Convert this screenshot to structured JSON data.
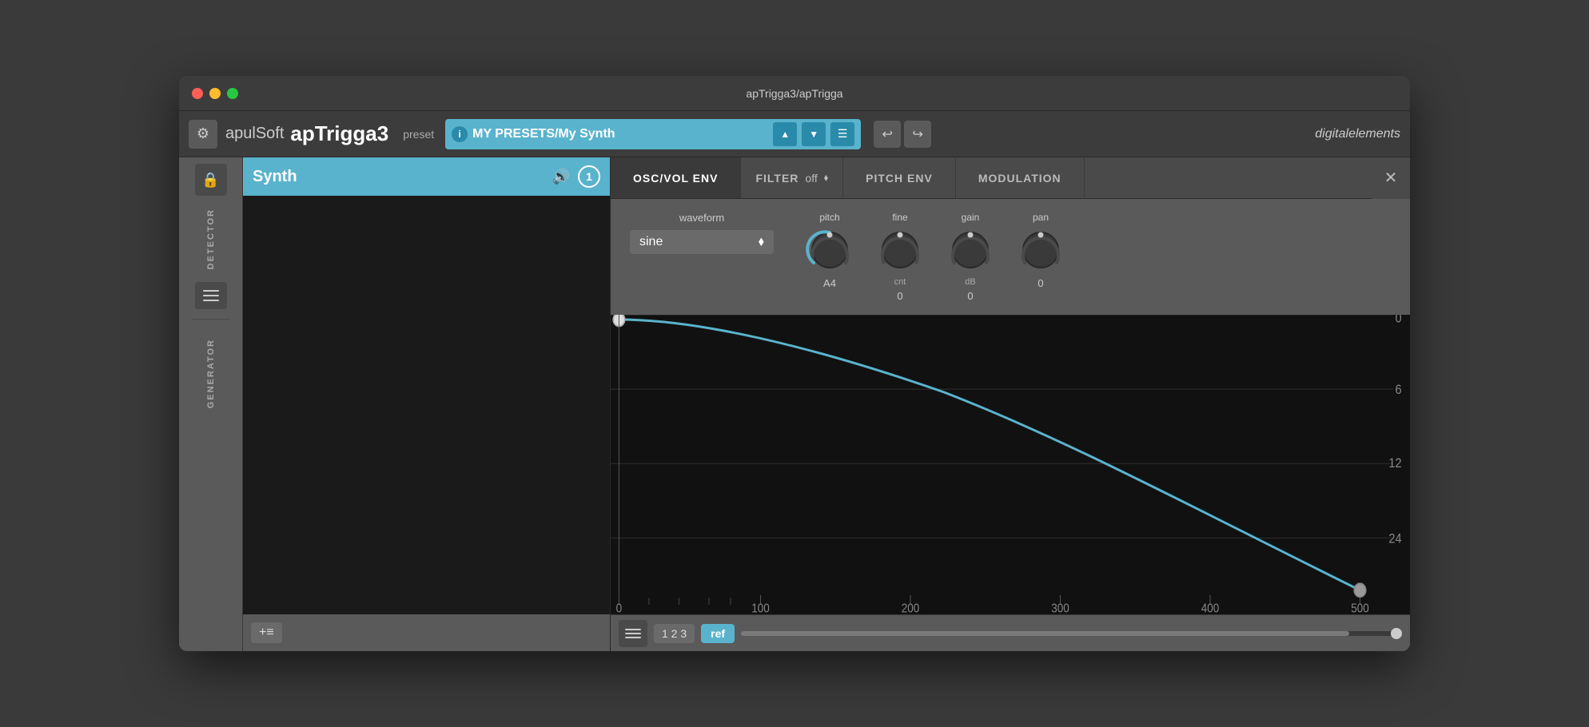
{
  "window": {
    "title": "apTrigga3/apTrigga"
  },
  "titlebar": {
    "title": "apTrigga3/apTrigga",
    "close_btn": "×",
    "min_btn": "–",
    "max_btn": "+"
  },
  "toolbar": {
    "gear_icon": "⚙",
    "brand_light": "apulSoft",
    "brand_bold": "apTrigga3",
    "preset_label": "preset",
    "preset_info_icon": "i",
    "preset_name": "MY PRESETS/My Synth",
    "nav_up": "▲",
    "nav_down": "▼",
    "menu_icon": "☰",
    "undo_icon": "↩",
    "redo_icon": "↪",
    "brand_right": "digitalelements"
  },
  "sidebar": {
    "lock_icon": "🔒",
    "detector_label": "DETECTOR",
    "menu_icon": "☰",
    "generator_label": "GENERATOR"
  },
  "left_panel": {
    "title": "Synth",
    "speaker_icon": "🔊",
    "number": "1",
    "add_btn": "+≡"
  },
  "tabs": {
    "osc_vol_env": "OSC/VOL ENV",
    "filter": "FILTER",
    "filter_value": "off",
    "pitch_env": "PITCH ENV",
    "modulation": "MODULATION",
    "close_icon": "✕"
  },
  "controls": {
    "waveform_label": "waveform",
    "waveform_value": "sine",
    "waveform_arrow": "⬧",
    "knobs": [
      {
        "label": "pitch",
        "sublabel": "",
        "value": "A4",
        "arc_pct": 0.5
      },
      {
        "label": "fine",
        "sublabel": "cnt",
        "value": "0",
        "arc_pct": 0.5
      },
      {
        "label": "gain",
        "sublabel": "dB",
        "value": "0",
        "arc_pct": 0.5
      },
      {
        "label": "pan",
        "sublabel": "",
        "value": "0",
        "arc_pct": 0.5
      }
    ]
  },
  "envelope": {
    "y_labels": [
      "0",
      "6",
      "12",
      "24"
    ],
    "x_labels": [
      "0",
      "100",
      "200",
      "300",
      "400",
      "500"
    ]
  },
  "bottom_bar": {
    "menu_icon": "☰",
    "num_btn": "1 2 3",
    "ref_btn": "ref",
    "slider_fill_pct": 92
  }
}
